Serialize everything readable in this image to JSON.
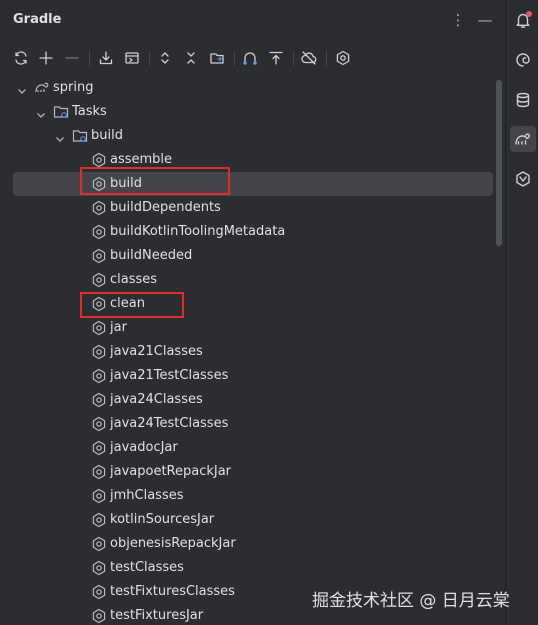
{
  "panel": {
    "title": "Gradle"
  },
  "toolbar": {
    "buttons": [
      "reload-icon",
      "add-icon",
      "remove-icon",
      "download-icon",
      "run-config-icon",
      "expand-all-icon",
      "collapse-all-icon",
      "link-project-icon",
      "dependencies-icon",
      "offline-mode-icon",
      "settings-icon"
    ]
  },
  "tree": {
    "root": "spring",
    "tasks": "Tasks",
    "group": "build",
    "items": [
      "assemble",
      "build",
      "buildDependents",
      "buildKotlinToolingMetadata",
      "buildNeeded",
      "classes",
      "clean",
      "jar",
      "java21Classes",
      "java21TestClasses",
      "java24Classes",
      "java24TestClasses",
      "javadocJar",
      "javapoetRepackJar",
      "jmhClasses",
      "kotlinSourcesJar",
      "objenesisRepackJar",
      "testClasses",
      "testFixturesClasses",
      "testFixturesJar"
    ],
    "selected": "build"
  },
  "watermark": "掘金技术社区 @ 日月云棠",
  "colors": {
    "background": "#2b2d30",
    "selection": "#43454a",
    "highlight_box": "#e52a2a",
    "notification_dot": "#e55765"
  }
}
